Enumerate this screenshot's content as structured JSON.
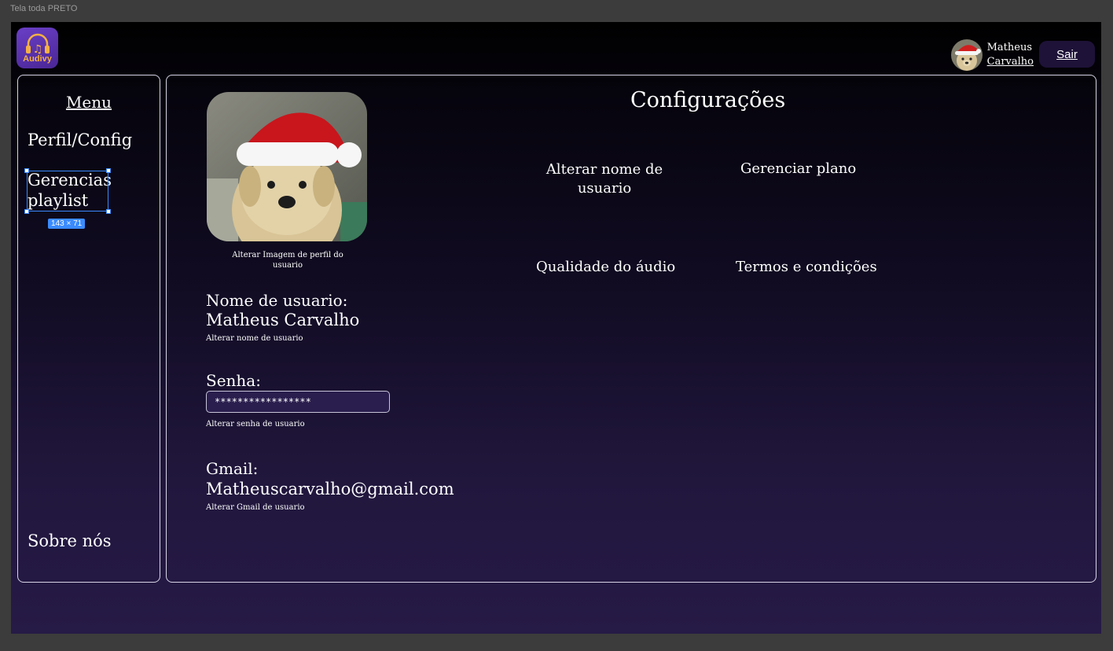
{
  "canvas": {
    "frame_label": "Tela toda PRETO"
  },
  "header": {
    "logo_text": "Audivy",
    "user_first": "Matheus",
    "user_last": "Carvalho",
    "logout_label": "Sair"
  },
  "sidebar": {
    "title": "Menu",
    "items": [
      {
        "label": "Perfil/Config"
      },
      {
        "label": "Gerencias playlist"
      },
      {
        "label": "Sobre nós"
      }
    ],
    "selection_badge": "143 × 71"
  },
  "main": {
    "title": "Configurações",
    "photo_caption": "Alterar Imagem de perfil do usuario",
    "options": [
      {
        "label": "Alterar nome de usuario"
      },
      {
        "label": "Gerenciar plano"
      },
      {
        "label": "Qualidade do áudio"
      },
      {
        "label": "Termos e condições"
      }
    ],
    "username": {
      "label": "Nome de usuario:",
      "value": "Matheus Carvalho",
      "link": "Alterar nome de usuario"
    },
    "password": {
      "label": "Senha:",
      "value": "*****************",
      "link": "Alterar senha de usuario"
    },
    "gmail": {
      "label": "Gmail:",
      "value": "Matheuscarvalho@gmail.com",
      "link": "Alterar Gmail de usuario"
    }
  },
  "colors": {
    "accent": "#3b8bff",
    "logo_bg": "#5a32b0",
    "logo_text": "#f5b043",
    "button_bg": "#1e1238"
  }
}
